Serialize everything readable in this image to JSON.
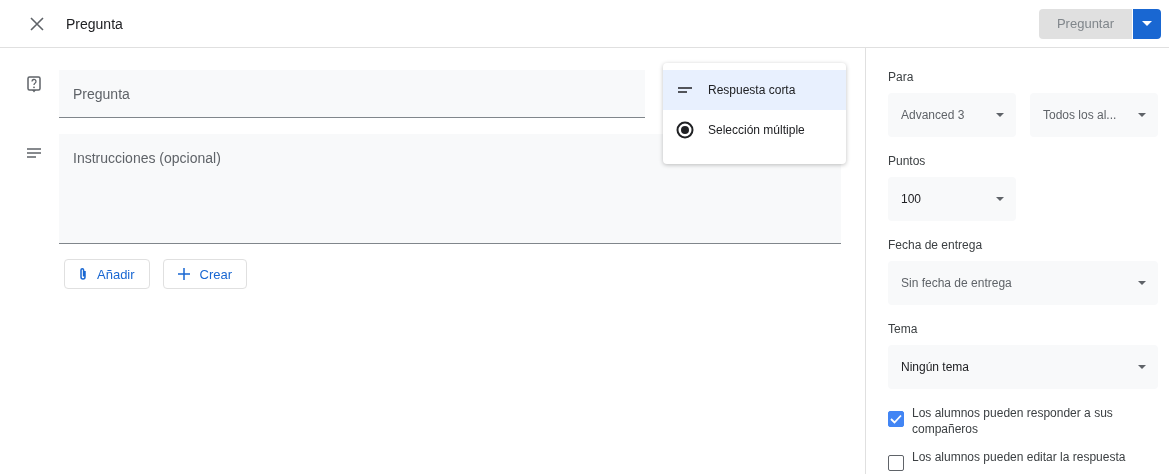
{
  "header": {
    "title": "Pregunta",
    "submit_button": "Preguntar",
    "submit_disabled": true
  },
  "question": {
    "placeholder": "Pregunta"
  },
  "instructions": {
    "placeholder": "Instrucciones (opcional)"
  },
  "attach_buttons": [
    {
      "kind": "attach",
      "label": "Añadir"
    },
    {
      "kind": "create",
      "label": "Crear"
    }
  ],
  "type_menu": [
    {
      "kind": "short",
      "label": "Respuesta corta",
      "selected": true
    },
    {
      "kind": "multiple",
      "label": "Selección múltiple",
      "selected": false
    }
  ],
  "panel": {
    "for_label": "Para",
    "class_select": "Advanced 3",
    "students_select": "Todos los al...",
    "points_label": "Puntos",
    "points_select": "100",
    "due_label": "Fecha de entrega",
    "due_select": "Sin fecha de entrega",
    "topic_label": "Tema",
    "topic_select": "Ningún tema",
    "options": [
      {
        "label": "Los alumnos pueden responder a sus compañeros",
        "checked": true
      },
      {
        "label": "Los alumnos pueden editar la respuesta",
        "checked": false
      }
    ]
  }
}
